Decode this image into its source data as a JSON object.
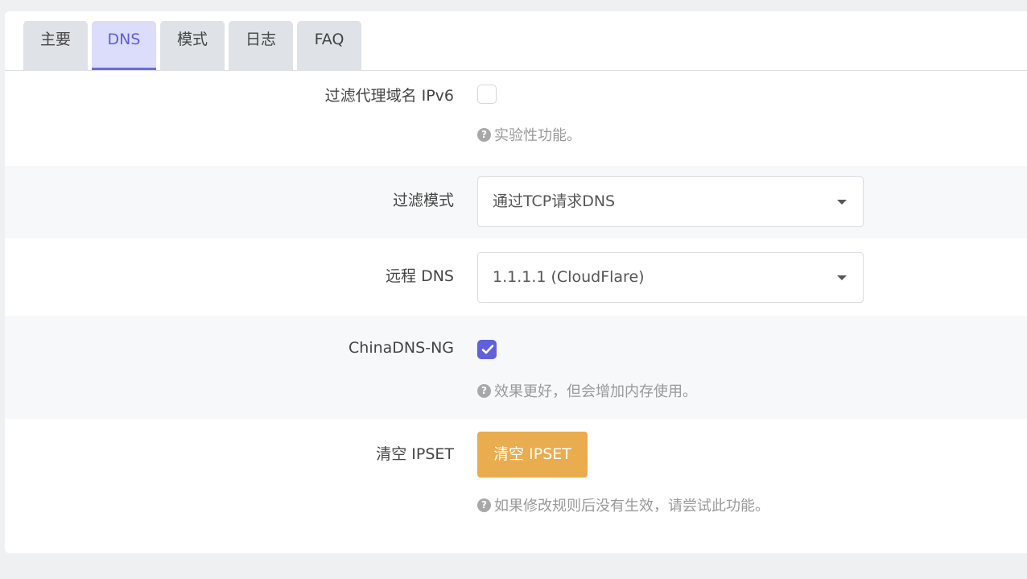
{
  "tabs": [
    {
      "label": "主要",
      "active": false
    },
    {
      "label": "DNS",
      "active": true
    },
    {
      "label": "模式",
      "active": false
    },
    {
      "label": "日志",
      "active": false
    },
    {
      "label": "FAQ",
      "active": false
    }
  ],
  "filter_ipv6": {
    "label": "过滤代理域名 IPv6",
    "checked": false,
    "help": "实验性功能。"
  },
  "filter_mode": {
    "label": "过滤模式",
    "value": "通过TCP请求DNS"
  },
  "remote_dns": {
    "label": "远程 DNS",
    "value": "1.1.1.1 (CloudFlare)"
  },
  "chinadns_ng": {
    "label": "ChinaDNS-NG",
    "checked": true,
    "help": "效果更好，但会增加内存使用。"
  },
  "clear_ipset": {
    "label": "清空 IPSET",
    "button_label": "清空 IPSET",
    "help": "如果修改规则后没有生效，请尝试此功能。"
  },
  "colors": {
    "accent": "#6060d8",
    "warning_button": "#e9ac4e",
    "active_tab_bg": "#dcdcfb"
  },
  "icons": {
    "help": "question-circle-icon",
    "check": "check-icon",
    "dropdown": "caret-down-icon"
  }
}
